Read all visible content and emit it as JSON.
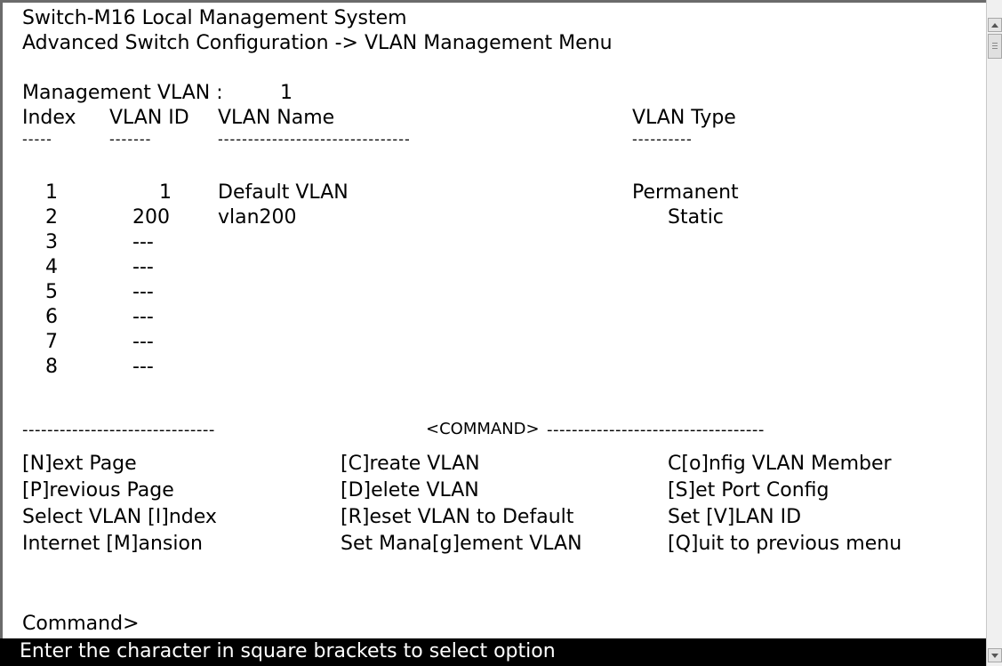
{
  "header": {
    "title": "Switch-M16 Local Management System",
    "breadcrumb": "Advanced Switch Configuration -> VLAN Management Menu"
  },
  "management_vlan": {
    "label": "Management VLAN :",
    "value": "1"
  },
  "table": {
    "columns": [
      "Index",
      "VLAN ID",
      "VLAN Name",
      "VLAN Type"
    ],
    "dashes": [
      "-----",
      "-------",
      "--------------------------------",
      "----------"
    ],
    "rows": [
      {
        "index": "1",
        "vlan_id": "1",
        "name": "Default VLAN",
        "type": "Permanent"
      },
      {
        "index": "2",
        "vlan_id": "200",
        "name": "vlan200",
        "type": "Static"
      },
      {
        "index": "3",
        "vlan_id": "---",
        "name": "",
        "type": ""
      },
      {
        "index": "4",
        "vlan_id": "---",
        "name": "",
        "type": ""
      },
      {
        "index": "5",
        "vlan_id": "---",
        "name": "",
        "type": ""
      },
      {
        "index": "6",
        "vlan_id": "---",
        "name": "",
        "type": ""
      },
      {
        "index": "7",
        "vlan_id": "---",
        "name": "",
        "type": ""
      },
      {
        "index": "8",
        "vlan_id": "---",
        "name": "",
        "type": ""
      }
    ]
  },
  "command_section": {
    "divider_left": "-------------------------------",
    "divider_label": "<COMMAND>",
    "divider_right": "-----------------------------------",
    "commands": [
      [
        "[N]ext Page",
        "[C]reate VLAN",
        "C[o]nfig VLAN Member"
      ],
      [
        "[P]revious Page",
        "[D]elete VLAN",
        "[S]et Port Config"
      ],
      [
        "Select VLAN [I]ndex",
        "[R]eset VLAN to Default",
        "Set [V]LAN ID"
      ],
      [
        "Internet [M]ansion",
        "Set Mana[g]ement VLAN",
        "[Q]uit to previous menu"
      ]
    ]
  },
  "prompt": "Command>",
  "status_bar": "Enter the character in square brackets to select option",
  "colors": {
    "background": "#ffffff",
    "text": "#000000",
    "status_bg": "#000000",
    "status_text": "#ffffff"
  },
  "icons": {
    "scroll_up": "scroll-up-arrow-icon",
    "scroll_down": "scroll-down-arrow-icon"
  }
}
